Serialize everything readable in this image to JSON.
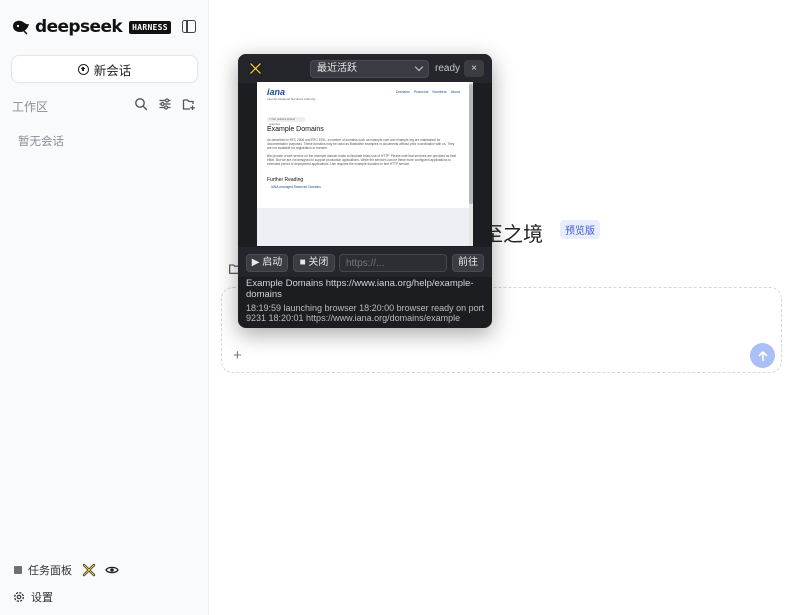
{
  "sidebar": {
    "brand_word": "deepseek",
    "brand_badge": "HARNESS",
    "new_chat_label": "新会话",
    "workspace_label": "工作区",
    "empty_label": "暂无会话",
    "task_panel_label": "任务面板",
    "settings_label": "设置"
  },
  "main": {
    "hero_title": "至之境",
    "hero_badge": "预览版",
    "composer_placeholder": "",
    "composer_plus": "+"
  },
  "browser": {
    "select_value": "最近活跃",
    "status": "ready",
    "close_label": "×",
    "start_label": "▶ 启动",
    "stop_label": "■ 关闭",
    "url_placeholder": "https://...",
    "go_label": "前往",
    "page_info": "Example Domains https://www.iana.org/help/example-domains",
    "log": "18:19:59 launching browser 18:20:00 browser ready on port 9231 18:20:01 https://www.iana.org/domains/example",
    "preview": {
      "logo": "iana",
      "logo_sub": "Internet Assigned Numbers Authority",
      "nav": [
        "Domains",
        "Protocols",
        "Numbers",
        "About"
      ],
      "crumb": "< Our policies & best practices",
      "h1": "Example Domains",
      "p1": "As described in RFC 2606 and RFC 6761, a number of domains such as example.com and example.org are maintained for documentation purposes. These domains may be used as illustrative examples in documents without prior coordination with us. They are not available for registration or transfer.",
      "p2": "We provide a web service on the example domain hosts to illustrate basic use of HTTP. Please note that services are provided as best effort. But we are not designed to support production applications. While the services can be these more configured applications to extended period of deployment applications. Use requires the example domains in test HTTP service.",
      "h2": "Further Reading",
      "li": "IANA-managed Reserved Domains"
    }
  }
}
